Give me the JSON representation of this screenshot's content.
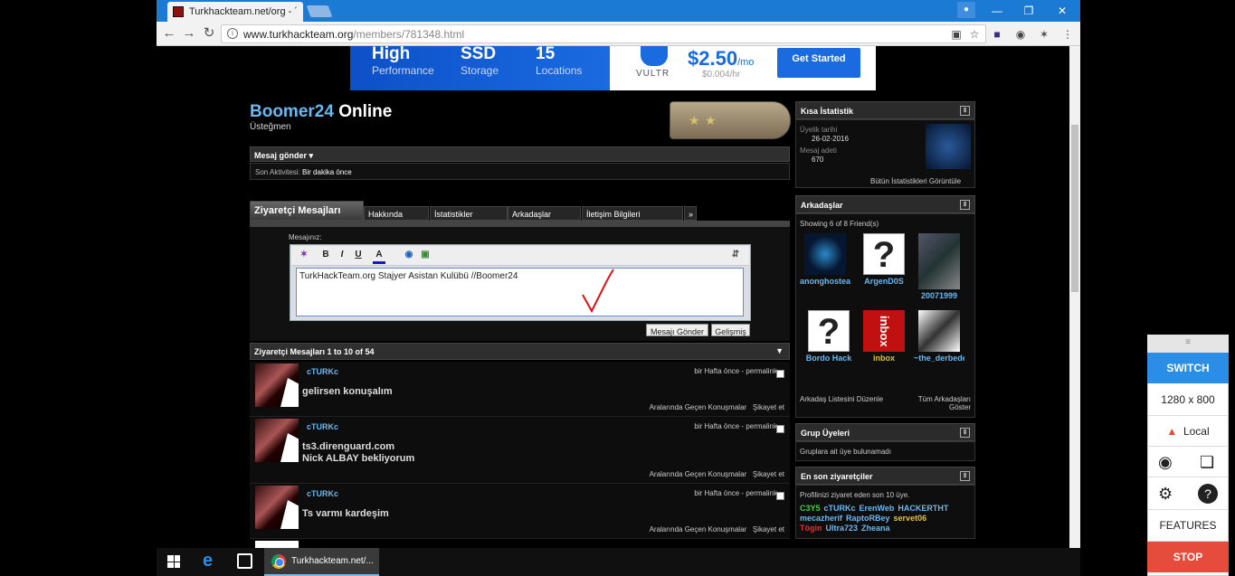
{
  "browser": {
    "tab_title": "Turkhackteam.net/org - ´",
    "url_domain": "www.turkhackteam.org",
    "url_path": "/members/781348.html",
    "url_prefix": "www."
  },
  "ad": {
    "c1_big": "High",
    "c1_small": "Performance",
    "c2_big": "SSD",
    "c2_small": "Storage",
    "c3_big": "15",
    "c3_small": "Locations",
    "brand": "VULTR",
    "price": "$2.50",
    "price_unit": "/mo",
    "price_sub": "$0.004/hr",
    "cta": "Get Started"
  },
  "profile": {
    "username": "Boomer24",
    "status": "Online",
    "rank": "Üsteğmen",
    "send_message": "Mesaj gönder ▾",
    "activity_label": "Son Aktivitesi:",
    "activity_value": "Bir dakika önce"
  },
  "tabs": [
    "Ziyaretçi Mesajları",
    "Hakkında",
    "İstatistikler",
    "Arkadaşlar",
    "İletişim Bilgileri",
    "»"
  ],
  "editor": {
    "label": "Mesajınız:",
    "content": "TurkHackTeam.org Stajyer Asistan Kulübü //Boomer24",
    "send": "Mesajı Gönder",
    "advanced": "Gelişmiş",
    "tools": [
      "B",
      "I",
      "U",
      "A"
    ]
  },
  "messages_header": "Ziyaretçi Mesajları 1 to 10 of 54",
  "messages": [
    {
      "author": "cTURKc",
      "time": "bir Hafta önce - permalink",
      "body1": "gelirsen konuşalım",
      "body2": "",
      "conv": "Aralarında Geçen Konuşmalar",
      "report": "Şikayet et"
    },
    {
      "author": "cTURKc",
      "time": "bir Hafta önce - permalink",
      "body1": "ts3.direnguard.com",
      "body2": "Nick ALBAY bekliyorum",
      "conv": "Aralarında Geçen Konuşmalar",
      "report": "Şikayet et"
    },
    {
      "author": "cTURKc",
      "time": "bir Hafta önce - permalink",
      "body1": "Ts varmı kardeşim",
      "body2": "",
      "conv": "Aralarında Geçen Konuşmalar",
      "report": "Şikayet et"
    }
  ],
  "sidebar": {
    "stats_title": "Kısa İstatistik",
    "join_label": "Üyelik tarihi",
    "join_date": "26-02-2016",
    "posts_label": "Mesaj adeti",
    "posts": "670",
    "all_stats": "Bütün İstatistikleri Görüntüle",
    "friends_title": "Arkadaşlar",
    "friends_showing": "Showing 6 of 8 Friend(s)",
    "friends": [
      {
        "name": "anonghostear"
      },
      {
        "name": "ArgenD0S"
      },
      {
        "name": "20071999"
      },
      {
        "name": "Bordo Hack"
      },
      {
        "name": "inbox"
      },
      {
        "name": "~the_derbede"
      }
    ],
    "edit_friends": "Arkadaş Listesini Düzenle",
    "all_friends": "Tüm Arkadaşları Göster",
    "groups_title": "Grup Üyeleri",
    "groups_text": "Gruplara ait üye bulunamadı",
    "visitors_title": "En son ziyaretçiler",
    "visitors_text": "Profilinizi ziyaret eden son 10 üye.",
    "visitors": [
      {
        "name": "C3Y5",
        "color": "#3fd43f"
      },
      {
        "name": "cTURKc",
        "color": "#6ab8f0"
      },
      {
        "name": "ErenWeb",
        "color": "#6ab8f0"
      },
      {
        "name": "HACKERTHT",
        "color": "#6ab8f0"
      },
      {
        "name": "mecazherif",
        "color": "#6ab8f0"
      },
      {
        "name": "RaptoRBey",
        "color": "#6ab8f0"
      },
      {
        "name": "servet06",
        "color": "#e0c040"
      },
      {
        "name": "Tögin",
        "color": "#e03030"
      },
      {
        "name": "Ultra723",
        "color": "#6ab8f0"
      },
      {
        "name": "Zheana",
        "color": "#6ab8f0"
      }
    ]
  },
  "panel": {
    "switch": "SWITCH",
    "resolution": "1280 x 800",
    "local": "Local",
    "features": "FEATURES",
    "stop": "STOP"
  },
  "taskbar": {
    "chrome_item": "Turkhackteam.net/..."
  }
}
